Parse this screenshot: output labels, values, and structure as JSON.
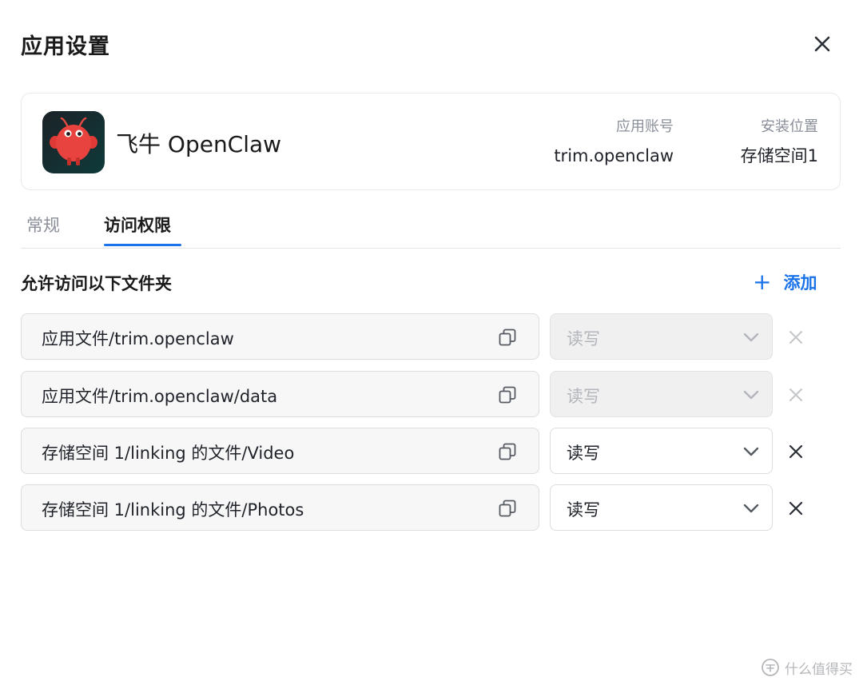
{
  "dialog": {
    "title": "应用设置"
  },
  "app": {
    "name": "飞牛 OpenClaw",
    "account_label": "应用账号",
    "account_value": "trim.openclaw",
    "location_label": "安装位置",
    "location_value": "存储空间1",
    "icon": "red-claw-mascot-icon"
  },
  "tabs": [
    {
      "label": "常规",
      "active": false
    },
    {
      "label": "访问权限",
      "active": true
    }
  ],
  "access": {
    "section_title": "允许访问以下文件夹",
    "add_label": "添加",
    "folders": [
      {
        "path": "应用文件/trim.openclaw",
        "permission": "读写",
        "disabled": true
      },
      {
        "path": "应用文件/trim.openclaw/data",
        "permission": "读写",
        "disabled": true
      },
      {
        "path": "存储空间 1/linking 的文件/Video",
        "permission": "读写",
        "disabled": false
      },
      {
        "path": "存储空间 1/linking 的文件/Photos",
        "permission": "读写",
        "disabled": false
      }
    ]
  },
  "watermark": {
    "text": "什么值得买",
    "icon": "zhi-badge-icon"
  },
  "colors": {
    "accent": "#1a73e8",
    "muted_text": "#8a8f99",
    "disabled_bg": "#f0f0f1"
  }
}
